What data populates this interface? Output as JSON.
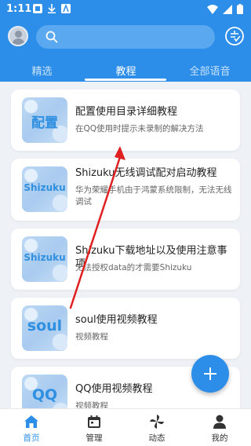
{
  "status_bar": {
    "time": "1:11"
  },
  "tabs": [
    {
      "label": "精选",
      "active": false
    },
    {
      "label": "教程",
      "active": true
    },
    {
      "label": "全部语音",
      "active": false
    }
  ],
  "cards": [
    {
      "thumb_label": "配置",
      "title": "配置使用目录详细教程",
      "subtitle": "在QQ使用时提示未录制的解决方法"
    },
    {
      "thumb_label": "Shizuku",
      "title": "Shizuku无线调试配对启动教程",
      "subtitle": "华为荣耀手机由于鸿蒙系统限制，无法无线调试"
    },
    {
      "thumb_label": "Shizuku",
      "title": "Shizuku下载地址以及使用注意事项",
      "subtitle": "无法授权data的才需要Shizuku"
    },
    {
      "thumb_label": "soul",
      "title": "soul使用视频教程",
      "subtitle": "视频教程"
    },
    {
      "thumb_label": "QQ",
      "title": "QQ使用视频教程",
      "subtitle": "视频教程"
    }
  ],
  "bottom_nav": [
    {
      "label": "首页",
      "icon": "home-icon",
      "active": true
    },
    {
      "label": "管理",
      "icon": "calendar-icon",
      "active": false
    },
    {
      "label": "动态",
      "icon": "pinwheel-icon",
      "active": false
    },
    {
      "label": "我的",
      "icon": "person-icon",
      "active": false
    }
  ],
  "colors": {
    "primary": "#2c8ee9",
    "annotation_arrow": "#e02020"
  }
}
